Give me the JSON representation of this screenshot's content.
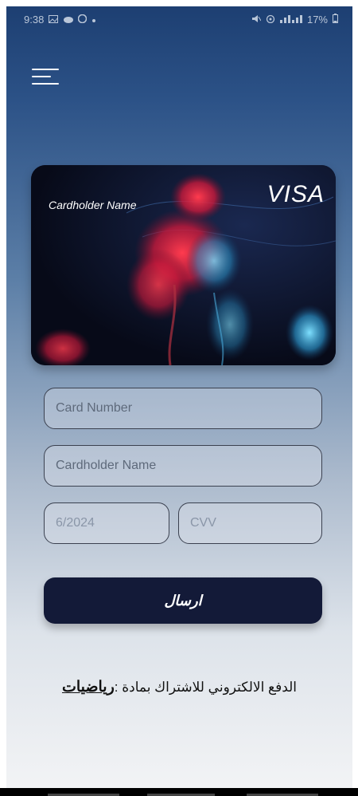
{
  "status_bar": {
    "time": "9:38",
    "left_icons": [
      "gallery-icon",
      "cloud-icon",
      "messenger-icon",
      "dot-icon"
    ],
    "right_icons": [
      "mute-icon",
      "hotspot-icon",
      "signal-icon"
    ],
    "battery": "17%"
  },
  "menu": {
    "icon": "hamburger-icon"
  },
  "card": {
    "holder_label": "Cardholder Name",
    "brand": "VISA"
  },
  "form": {
    "card_number_placeholder": "Card Number",
    "cardholder_placeholder": "Cardholder Name",
    "expiry_placeholder": "6/2024",
    "cvv_placeholder": "CVV",
    "submit_label": "ارسال"
  },
  "footer": {
    "prefix": "الدفع الالكتروني للاشتراك بمادة :",
    "subject": "رياضيات"
  },
  "colors": {
    "bg_top": "#1d3f72",
    "bg_bottom": "#f2f3f5",
    "button": "#131a38",
    "field_border": "#3b4150"
  }
}
